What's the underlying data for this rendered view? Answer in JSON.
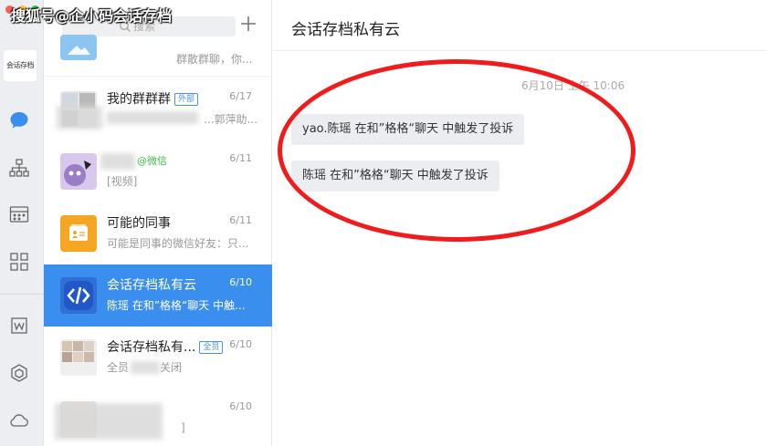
{
  "watermark": "搜狐号@企小码会话存档",
  "rail": {
    "avatar_label": "会话存档",
    "icons": [
      "chat-icon",
      "org-icon",
      "calendar-icon",
      "apps-icon",
      "doc-icon",
      "cube-icon",
      "cloud-icon"
    ]
  },
  "search": {
    "placeholder": "搜索"
  },
  "chats": [
    {
      "name": "",
      "date": "",
      "preview": "群散群聊，你...",
      "tag": ""
    },
    {
      "name": "我的群群群",
      "tag": "外部",
      "date": "6/17",
      "preview": "...郭萍助..."
    },
    {
      "name": "",
      "wechat": "@微信",
      "date": "6/11",
      "preview": "[视频]"
    },
    {
      "name": "可能的同事",
      "date": "6/11",
      "preview": "可能是同事的微信好友：只..."
    },
    {
      "name": "会话存档私有云",
      "date": "6/10",
      "preview": "陈瑶 在和”格格“聊天 中触...",
      "active": true
    },
    {
      "name": "会话存档私有...",
      "tag": "全员",
      "date": "6/10",
      "preview_left": "全员",
      "preview_right": "关闭"
    },
    {
      "name": "",
      "date": "6/10",
      "preview": "]"
    }
  ],
  "conversation": {
    "title": "会话存档私有云",
    "timestamp": "6月10日 上午 10:06",
    "messages": [
      "yao.陈瑶 在和”格格“聊天 中触发了投诉",
      "陈瑶 在和”格格“聊天 中触发了投诉"
    ]
  },
  "colors": {
    "active": "#3a8fee",
    "highlight_ring": "#f01c1c",
    "rail_bg": "#eceef2"
  }
}
